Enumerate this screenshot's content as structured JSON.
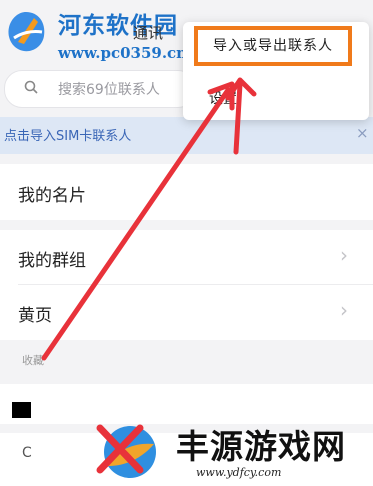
{
  "watermark_top": {
    "title": "河东软件园",
    "url": "www.pc0359.cn"
  },
  "header": {
    "title_fragment": "通讯"
  },
  "search": {
    "placeholder": "搜索69位联系人"
  },
  "popup_menu": {
    "items": [
      {
        "label": "导入或导出联系人",
        "highlight_color": "#f07a1a"
      },
      {
        "label": "设置"
      }
    ]
  },
  "sim_banner": {
    "label": "点击导入SIM卡联系人",
    "close": "×"
  },
  "rows": {
    "my_card": "我的名片",
    "my_groups": "我的群组",
    "yellow_pages": "黄页",
    "chevron": "›"
  },
  "favorites": {
    "section_label": "收藏"
  },
  "index_letter": "C",
  "watermark_bottom": {
    "title": "丰源游戏网",
    "url": "www.ydfcy.com"
  },
  "colors": {
    "arrow": "#e8323a",
    "accent_blue": "#3a66b6",
    "brand_blue": "#1e72c8"
  }
}
